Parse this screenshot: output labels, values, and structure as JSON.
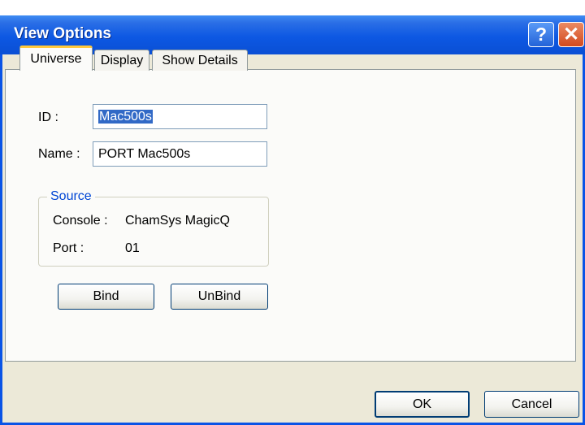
{
  "window": {
    "title": "View Options",
    "help_glyph": "?",
    "close_glyph": "✕"
  },
  "tabs": [
    {
      "label": "Universe",
      "active": true
    },
    {
      "label": "Display",
      "active": false
    },
    {
      "label": "Show Details",
      "active": false
    }
  ],
  "universe": {
    "id_label": "ID :",
    "id_value": "Mac500s",
    "name_label": "Name :",
    "name_value": "PORT Mac500s",
    "source": {
      "title": "Source",
      "console_label": "Console :",
      "console_value": "ChamSys MagicQ",
      "port_label": "Port :",
      "port_value": "01"
    },
    "bind_label": "Bind",
    "unbind_label": "UnBind"
  },
  "footer": {
    "ok_label": "OK",
    "cancel_label": "Cancel"
  },
  "colors": {
    "titlebar": "#0a54e6",
    "dialog_bg": "#ece9d8",
    "selection": "#3169c6",
    "group_title": "#0046d5",
    "active_tab_accent": "#ffc83c"
  }
}
